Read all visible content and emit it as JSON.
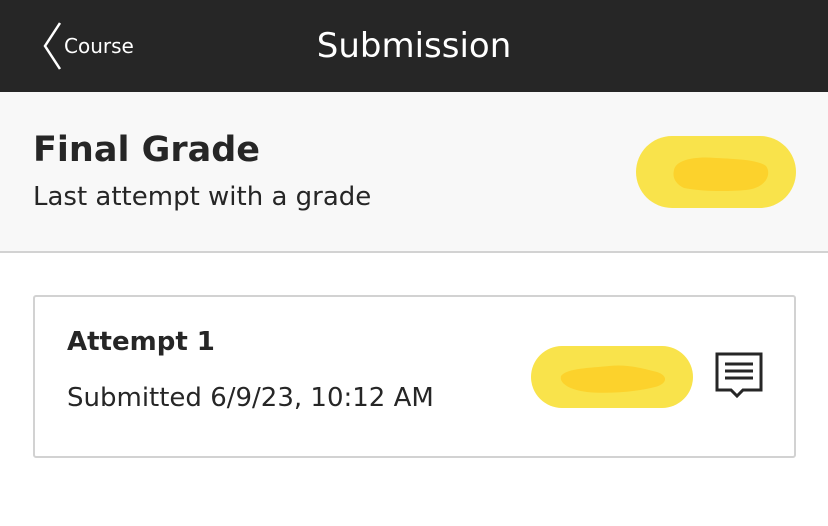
{
  "header": {
    "back_label": "Course",
    "title": "Submission",
    "background": "#262626"
  },
  "final_grade": {
    "title": "Final Grade",
    "subtitle": "Last attempt with a grade",
    "highlight_color": "#f9e34b"
  },
  "attempts": [
    {
      "title": "Attempt 1",
      "submitted": "Submitted 6/9/23, 10:12 AM",
      "icon": "feedback-comment-icon"
    }
  ]
}
